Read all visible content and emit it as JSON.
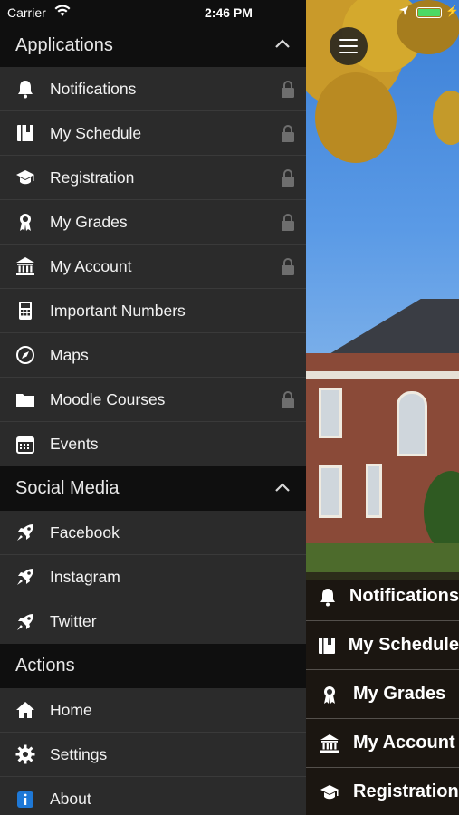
{
  "status_bar": {
    "carrier": "Carrier",
    "time": "2:46 PM"
  },
  "drawer": {
    "sections": [
      {
        "title": "Applications",
        "items": [
          {
            "label": "Notifications",
            "icon": "bell-icon",
            "locked": true
          },
          {
            "label": "My Schedule",
            "icon": "book-icon",
            "locked": true
          },
          {
            "label": "Registration",
            "icon": "graduation-cap-icon",
            "locked": true
          },
          {
            "label": "My Grades",
            "icon": "award-ribbon-icon",
            "locked": true
          },
          {
            "label": "My Account",
            "icon": "bank-icon",
            "locked": true
          },
          {
            "label": "Important Numbers",
            "icon": "calculator-icon",
            "locked": false
          },
          {
            "label": "Maps",
            "icon": "compass-icon",
            "locked": false
          },
          {
            "label": "Moodle Courses",
            "icon": "folder-icon",
            "locked": true
          },
          {
            "label": "Events",
            "icon": "calendar-icon",
            "locked": false
          }
        ]
      },
      {
        "title": "Social Media",
        "items": [
          {
            "label": "Facebook",
            "icon": "rocket-icon",
            "locked": false
          },
          {
            "label": "Instagram",
            "icon": "rocket-icon",
            "locked": false
          },
          {
            "label": "Twitter",
            "icon": "rocket-icon",
            "locked": false
          }
        ]
      },
      {
        "title": "Actions",
        "items": [
          {
            "label": "Home",
            "icon": "home-icon",
            "locked": false
          },
          {
            "label": "Settings",
            "icon": "gear-icon",
            "locked": false
          },
          {
            "label": "About",
            "icon": "info-icon",
            "locked": false
          }
        ]
      }
    ]
  },
  "background_menu": {
    "items": [
      {
        "label": "Notifications",
        "icon": "bell-icon"
      },
      {
        "label": "My Schedule",
        "icon": "book-icon"
      },
      {
        "label": "My Grades",
        "icon": "award-ribbon-icon"
      },
      {
        "label": "My Account",
        "icon": "bank-icon"
      },
      {
        "label": "Registration",
        "icon": "graduation-cap-icon"
      }
    ]
  },
  "colors": {
    "drawer_background": "#2b2b2b",
    "section_header_background": "#0f0f0f",
    "battery": "#4cd964",
    "info_icon": "#1e78d6"
  }
}
